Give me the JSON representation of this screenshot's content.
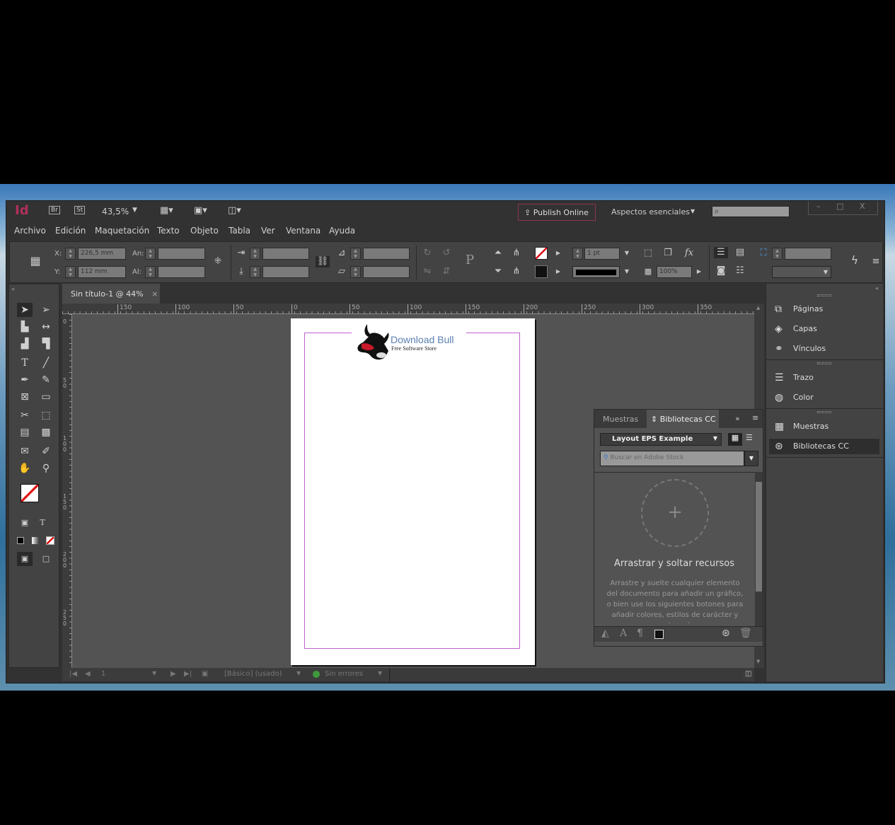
{
  "app": {
    "logo": "Id",
    "bridge": "Br",
    "stock": "St",
    "zoom": "43,5%",
    "publish": "Publish Online",
    "workspace": "Aspectos esenciales",
    "search_placeholder": ""
  },
  "menu": [
    "Archivo",
    "Edición",
    "Maquetación",
    "Texto",
    "Objeto",
    "Tabla",
    "Ver",
    "Ventana",
    "Ayuda"
  ],
  "control": {
    "x_label": "X:",
    "x_value": "226,5 mm",
    "y_label": "Y:",
    "y_value": "112 mm",
    "w_label": "An:",
    "h_label": "Al:",
    "stroke_weight": "1 pt",
    "opacity": "100%"
  },
  "document": {
    "tab_title": "Sin título-1 @ 44%",
    "close": "×",
    "logo_title": "Download Bull",
    "logo_subtitle": "Free Software Store"
  },
  "ruler": {
    "top": [
      "150",
      "100",
      "50",
      "0",
      "50",
      "100",
      "150",
      "200",
      "250",
      "300",
      "350"
    ],
    "left": [
      "0",
      "50",
      "100",
      "150",
      "200",
      "250"
    ]
  },
  "status": {
    "page": "1",
    "style": "[Básico] (usado)",
    "preflight": "Sin errores"
  },
  "dock": {
    "items": [
      "Páginas",
      "Capas",
      "Vínculos",
      "Trazo",
      "Color",
      "Muestras",
      "Bibliotecas CC"
    ]
  },
  "libraries": {
    "tab1": "Muestras",
    "tab2": "Bibliotecas CC",
    "library": "Layout EPS Example",
    "search_placeholder": "Buscar en Adobe Stock",
    "drop_title": "Arrastrar y soltar recursos",
    "drop_text": "Arrastre y suelte cualquier elemento del documento para añadir un gráfico, o bien use los siguientes botones para añadir colores, estilos de carácter y mucho más."
  },
  "colors": {
    "accent": "#ff3366",
    "margin": "#c060d0",
    "bg": "#323232"
  }
}
